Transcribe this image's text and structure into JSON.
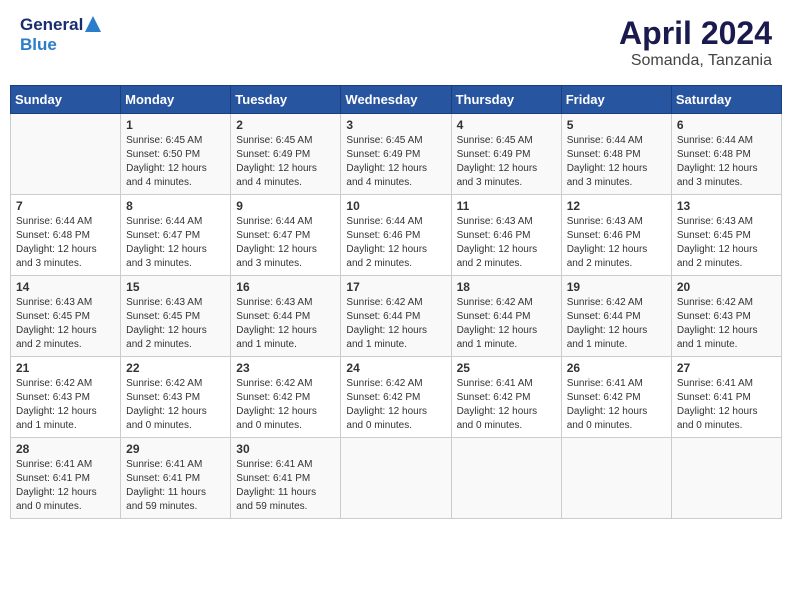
{
  "header": {
    "logo_general": "General",
    "logo_blue": "Blue",
    "month_year": "April 2024",
    "location": "Somanda, Tanzania"
  },
  "calendar": {
    "days_of_week": [
      "Sunday",
      "Monday",
      "Tuesday",
      "Wednesday",
      "Thursday",
      "Friday",
      "Saturday"
    ],
    "weeks": [
      [
        {
          "day": "",
          "sunrise": "",
          "sunset": "",
          "daylight": ""
        },
        {
          "day": "1",
          "sunrise": "Sunrise: 6:45 AM",
          "sunset": "Sunset: 6:50 PM",
          "daylight": "Daylight: 12 hours and 4 minutes."
        },
        {
          "day": "2",
          "sunrise": "Sunrise: 6:45 AM",
          "sunset": "Sunset: 6:49 PM",
          "daylight": "Daylight: 12 hours and 4 minutes."
        },
        {
          "day": "3",
          "sunrise": "Sunrise: 6:45 AM",
          "sunset": "Sunset: 6:49 PM",
          "daylight": "Daylight: 12 hours and 4 minutes."
        },
        {
          "day": "4",
          "sunrise": "Sunrise: 6:45 AM",
          "sunset": "Sunset: 6:49 PM",
          "daylight": "Daylight: 12 hours and 3 minutes."
        },
        {
          "day": "5",
          "sunrise": "Sunrise: 6:44 AM",
          "sunset": "Sunset: 6:48 PM",
          "daylight": "Daylight: 12 hours and 3 minutes."
        },
        {
          "day": "6",
          "sunrise": "Sunrise: 6:44 AM",
          "sunset": "Sunset: 6:48 PM",
          "daylight": "Daylight: 12 hours and 3 minutes."
        }
      ],
      [
        {
          "day": "7",
          "sunrise": "Sunrise: 6:44 AM",
          "sunset": "Sunset: 6:48 PM",
          "daylight": "Daylight: 12 hours and 3 minutes."
        },
        {
          "day": "8",
          "sunrise": "Sunrise: 6:44 AM",
          "sunset": "Sunset: 6:47 PM",
          "daylight": "Daylight: 12 hours and 3 minutes."
        },
        {
          "day": "9",
          "sunrise": "Sunrise: 6:44 AM",
          "sunset": "Sunset: 6:47 PM",
          "daylight": "Daylight: 12 hours and 3 minutes."
        },
        {
          "day": "10",
          "sunrise": "Sunrise: 6:44 AM",
          "sunset": "Sunset: 6:46 PM",
          "daylight": "Daylight: 12 hours and 2 minutes."
        },
        {
          "day": "11",
          "sunrise": "Sunrise: 6:43 AM",
          "sunset": "Sunset: 6:46 PM",
          "daylight": "Daylight: 12 hours and 2 minutes."
        },
        {
          "day": "12",
          "sunrise": "Sunrise: 6:43 AM",
          "sunset": "Sunset: 6:46 PM",
          "daylight": "Daylight: 12 hours and 2 minutes."
        },
        {
          "day": "13",
          "sunrise": "Sunrise: 6:43 AM",
          "sunset": "Sunset: 6:45 PM",
          "daylight": "Daylight: 12 hours and 2 minutes."
        }
      ],
      [
        {
          "day": "14",
          "sunrise": "Sunrise: 6:43 AM",
          "sunset": "Sunset: 6:45 PM",
          "daylight": "Daylight: 12 hours and 2 minutes."
        },
        {
          "day": "15",
          "sunrise": "Sunrise: 6:43 AM",
          "sunset": "Sunset: 6:45 PM",
          "daylight": "Daylight: 12 hours and 2 minutes."
        },
        {
          "day": "16",
          "sunrise": "Sunrise: 6:43 AM",
          "sunset": "Sunset: 6:44 PM",
          "daylight": "Daylight: 12 hours and 1 minute."
        },
        {
          "day": "17",
          "sunrise": "Sunrise: 6:42 AM",
          "sunset": "Sunset: 6:44 PM",
          "daylight": "Daylight: 12 hours and 1 minute."
        },
        {
          "day": "18",
          "sunrise": "Sunrise: 6:42 AM",
          "sunset": "Sunset: 6:44 PM",
          "daylight": "Daylight: 12 hours and 1 minute."
        },
        {
          "day": "19",
          "sunrise": "Sunrise: 6:42 AM",
          "sunset": "Sunset: 6:44 PM",
          "daylight": "Daylight: 12 hours and 1 minute."
        },
        {
          "day": "20",
          "sunrise": "Sunrise: 6:42 AM",
          "sunset": "Sunset: 6:43 PM",
          "daylight": "Daylight: 12 hours and 1 minute."
        }
      ],
      [
        {
          "day": "21",
          "sunrise": "Sunrise: 6:42 AM",
          "sunset": "Sunset: 6:43 PM",
          "daylight": "Daylight: 12 hours and 1 minute."
        },
        {
          "day": "22",
          "sunrise": "Sunrise: 6:42 AM",
          "sunset": "Sunset: 6:43 PM",
          "daylight": "Daylight: 12 hours and 0 minutes."
        },
        {
          "day": "23",
          "sunrise": "Sunrise: 6:42 AM",
          "sunset": "Sunset: 6:42 PM",
          "daylight": "Daylight: 12 hours and 0 minutes."
        },
        {
          "day": "24",
          "sunrise": "Sunrise: 6:42 AM",
          "sunset": "Sunset: 6:42 PM",
          "daylight": "Daylight: 12 hours and 0 minutes."
        },
        {
          "day": "25",
          "sunrise": "Sunrise: 6:41 AM",
          "sunset": "Sunset: 6:42 PM",
          "daylight": "Daylight: 12 hours and 0 minutes."
        },
        {
          "day": "26",
          "sunrise": "Sunrise: 6:41 AM",
          "sunset": "Sunset: 6:42 PM",
          "daylight": "Daylight: 12 hours and 0 minutes."
        },
        {
          "day": "27",
          "sunrise": "Sunrise: 6:41 AM",
          "sunset": "Sunset: 6:41 PM",
          "daylight": "Daylight: 12 hours and 0 minutes."
        }
      ],
      [
        {
          "day": "28",
          "sunrise": "Sunrise: 6:41 AM",
          "sunset": "Sunset: 6:41 PM",
          "daylight": "Daylight: 12 hours and 0 minutes."
        },
        {
          "day": "29",
          "sunrise": "Sunrise: 6:41 AM",
          "sunset": "Sunset: 6:41 PM",
          "daylight": "Daylight: 11 hours and 59 minutes."
        },
        {
          "day": "30",
          "sunrise": "Sunrise: 6:41 AM",
          "sunset": "Sunset: 6:41 PM",
          "daylight": "Daylight: 11 hours and 59 minutes."
        },
        {
          "day": "",
          "sunrise": "",
          "sunset": "",
          "daylight": ""
        },
        {
          "day": "",
          "sunrise": "",
          "sunset": "",
          "daylight": ""
        },
        {
          "day": "",
          "sunrise": "",
          "sunset": "",
          "daylight": ""
        },
        {
          "day": "",
          "sunrise": "",
          "sunset": "",
          "daylight": ""
        }
      ]
    ]
  }
}
